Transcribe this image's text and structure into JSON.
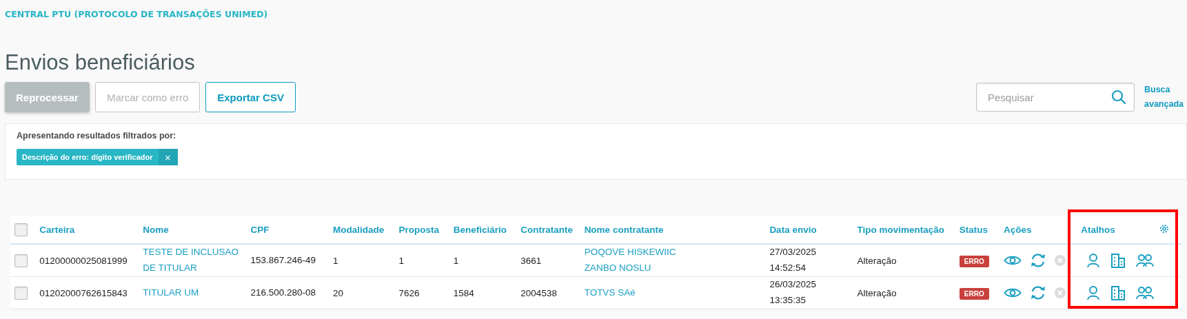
{
  "breadcrumb": "CENTRAL PTU (PROTOCOLO DE TRANSAÇÕES UNIMED)",
  "title": "Envios beneficiários",
  "buttons": [
    {
      "label": "Reprocessar",
      "kind": "primary",
      "disabled": true
    },
    {
      "label": "Marcar como erro",
      "kind": "secondary",
      "disabled": true
    },
    {
      "label": "Exportar CSV",
      "kind": "secondary",
      "disabled": false
    }
  ],
  "search": {
    "placeholder": "Pesquisar"
  },
  "advanced_search": "Busca avançada",
  "filter": {
    "label": "Apresentando resultados filtrados por:",
    "chips": [
      {
        "text": "Descrição do erro: dígito verificador",
        "close": "×"
      }
    ]
  },
  "table": {
    "columns": [
      "Carteira",
      "Nome",
      "CPF",
      "Modalidade",
      "Proposta",
      "Beneficiário",
      "Contratante",
      "Nome contratante",
      "Data envio",
      "Tipo movimentação",
      "Status",
      "Ações",
      "Atalhos"
    ],
    "select_all_checked": false,
    "rows": [
      {
        "checked": false,
        "carteira": "01200000025081999",
        "nome": "TESTE DE INCLUSAO DE TITULAR",
        "cpf": "153.867.246-49",
        "modalidade": "1",
        "proposta": "1",
        "beneficiario": "1",
        "contratante": "3661",
        "nome_contratante": "POQOVE HISKEWIIC ZANBO NOSLU",
        "data_envio": "27/03/2025 14:52:54",
        "tipo": "Alteração",
        "status": "ERRO"
      },
      {
        "checked": false,
        "carteira": "01202000762615843",
        "nome": "TITULAR UM",
        "cpf": "216.500.280-08",
        "modalidade": "20",
        "proposta": "7626",
        "beneficiario": "1584",
        "contratante": "2004538",
        "nome_contratante": "TOTVS SAé",
        "data_envio": "26/03/2025 13:35:35",
        "tipo": "Alteração",
        "status": "ERRO"
      }
    ]
  }
}
